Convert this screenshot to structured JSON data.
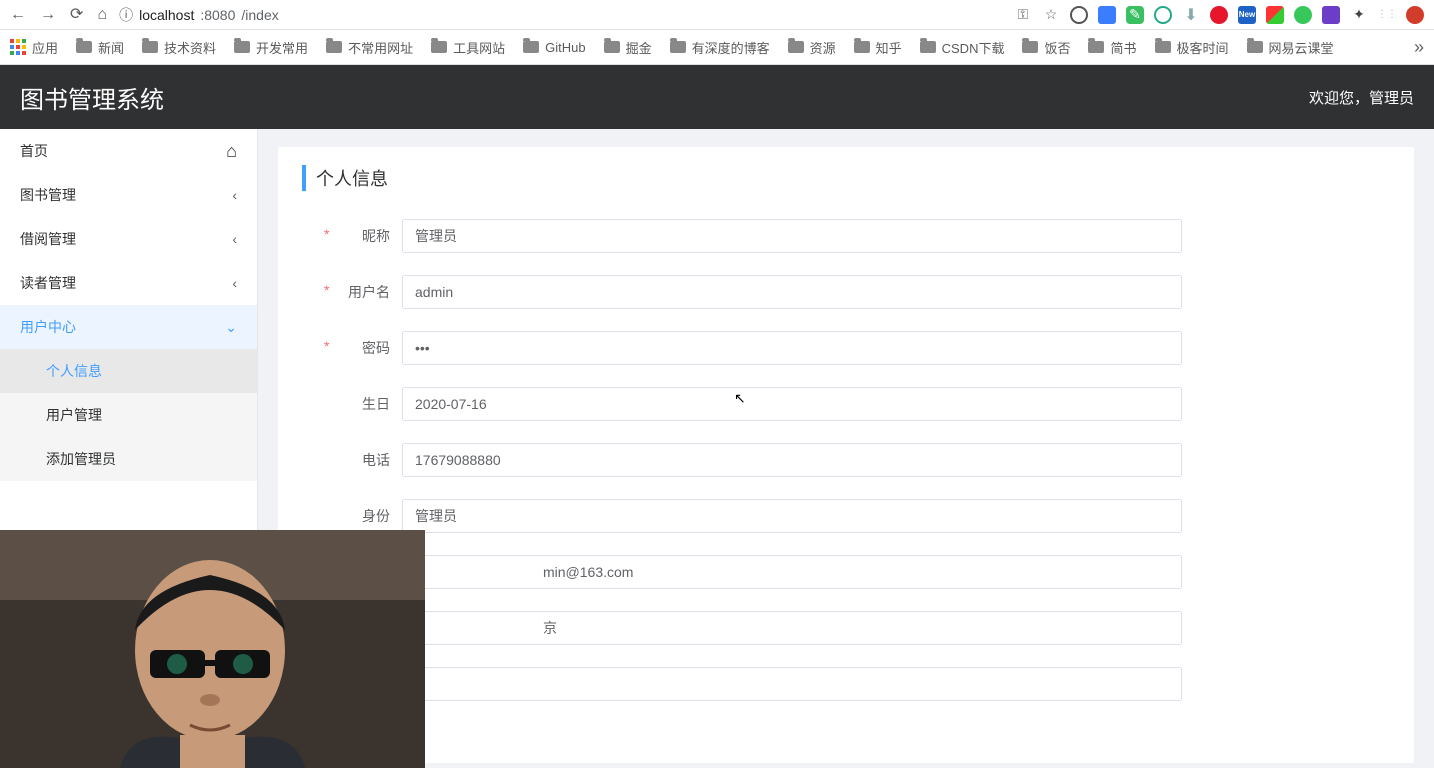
{
  "browser": {
    "url_host": "localhost",
    "url_port": ":8080",
    "url_path": "/index",
    "bookmarks": [
      "应用",
      "新闻",
      "技术资料",
      "开发常用",
      "不常用网址",
      "工具网站",
      "GitHub",
      "掘金",
      "有深度的博客",
      "资源",
      "知乎",
      "CSDN下载",
      "饭否",
      "简书",
      "极客时间",
      "网易云课堂"
    ]
  },
  "header": {
    "title": "图书管理系统",
    "welcome": "欢迎您，管理员"
  },
  "sidebar": {
    "home": "首页",
    "books": "图书管理",
    "borrow": "借阅管理",
    "readers": "读者管理",
    "usercenter": "用户中心",
    "sub_profile": "个人信息",
    "sub_usermgmt": "用户管理",
    "sub_addadmin": "添加管理员"
  },
  "page": {
    "title": "个人信息",
    "labels": {
      "nick": "昵称",
      "username": "用户名",
      "password": "密码",
      "birthday": "生日",
      "phone": "电话",
      "role": "身份",
      "email_visible": "min@163.com",
      "addr_visible": "京"
    },
    "values": {
      "nick": "管理员",
      "username": "admin",
      "password": "•••",
      "birthday": "2020-07-16",
      "phone": "17679088880",
      "role": "管理员"
    }
  }
}
